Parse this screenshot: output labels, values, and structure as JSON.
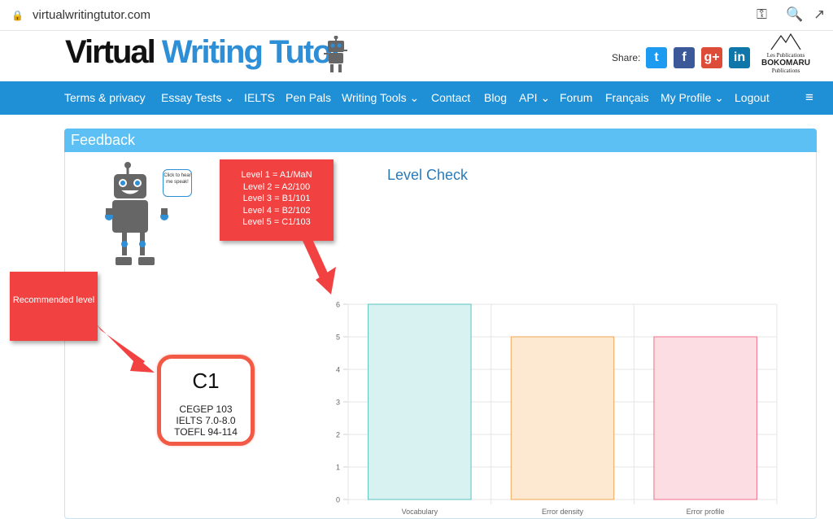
{
  "browser": {
    "url": "virtualwritingtutor.com"
  },
  "header": {
    "logo_part1": "Virtual",
    "logo_part2": "Writing Tutor",
    "share_label": "Share:",
    "social": [
      "twitter",
      "facebook",
      "google-plus",
      "linkedin"
    ],
    "publisher_small": "Les Publications",
    "publisher_name": "BOKOMARU",
    "publisher_sub": "Publications"
  },
  "nav": {
    "items": [
      "Terms & privacy",
      "Essay Tests ⌄",
      "IELTS",
      "Pen Pals",
      "Writing Tools ⌄",
      "Contact",
      "Blog",
      "API ⌄",
      "Forum",
      "Français",
      "My Profile ⌄",
      "Logout"
    ]
  },
  "panel": {
    "title": "Feedback",
    "speech": "Click to hear me speak!"
  },
  "annotations": {
    "levels": [
      "Level 1 = A1/MaN",
      "Level 2 = A2/100",
      "Level 3 = B1/101",
      "Level 4 = B2/102",
      "Level 5 = C1/103"
    ],
    "recommended": "Recommended level"
  },
  "result": {
    "level": "C1",
    "cegep": "CEGEP 103",
    "ielts": "IELTS 7.0-8.0",
    "toefl": "TOEFL 94-114"
  },
  "colors": {
    "nav": "#1f8fd6",
    "panel_head": "#5cc0f5",
    "callout": "#f24141"
  },
  "chart_data": {
    "type": "bar",
    "title": "Level Check",
    "categories": [
      "Vocabulary",
      "Error density",
      "Error profile"
    ],
    "values": [
      6,
      5,
      5
    ],
    "ylim": [
      0,
      6
    ],
    "yticks": [
      0,
      1,
      2,
      3,
      4,
      5,
      6
    ],
    "grid": true,
    "bar_fill": [
      "#d8f1f1",
      "#fde8d2",
      "#fcdde4"
    ],
    "bar_stroke": [
      "#5cc2c0",
      "#f2a752",
      "#f07088"
    ]
  }
}
